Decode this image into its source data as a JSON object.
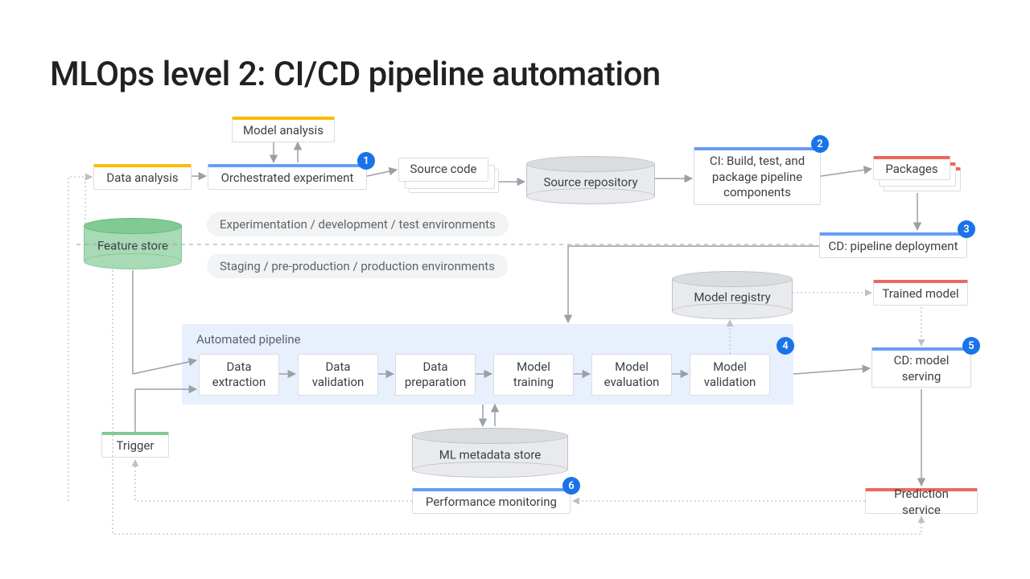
{
  "title": "MLOps level 2: CI/CD pipeline automation",
  "env_upper": "Experimentation / development / test environments",
  "env_lower": "Staging / pre-production / production environments",
  "auto_pipeline_title": "Automated pipeline",
  "nodes": {
    "data_analysis": "Data analysis",
    "model_analysis": "Model analysis",
    "orchestrated_experiment": "Orchestrated experiment",
    "source_code": "Source code",
    "source_repo": "Source repository",
    "ci_build": "CI: Build, test, and package pipeline components",
    "packages": "Packages",
    "cd_pipeline": "CD: pipeline deployment",
    "feature_store": "Feature store",
    "trigger": "Trigger",
    "model_registry": "Model registry",
    "trained_model": "Trained model",
    "cd_serving": "CD: model serving",
    "ml_metadata": "ML metadata store",
    "perf_monitoring": "Performance monitoring",
    "prediction_service": "Prediction service"
  },
  "stages": {
    "s1": "Data extraction",
    "s2": "Data validation",
    "s3": "Data preparation",
    "s4": "Model training",
    "s5": "Model evaluation",
    "s6": "Model validation"
  },
  "badges": {
    "b1": "1",
    "b2": "2",
    "b3": "3",
    "b4": "4",
    "b5": "5",
    "b6": "6"
  }
}
